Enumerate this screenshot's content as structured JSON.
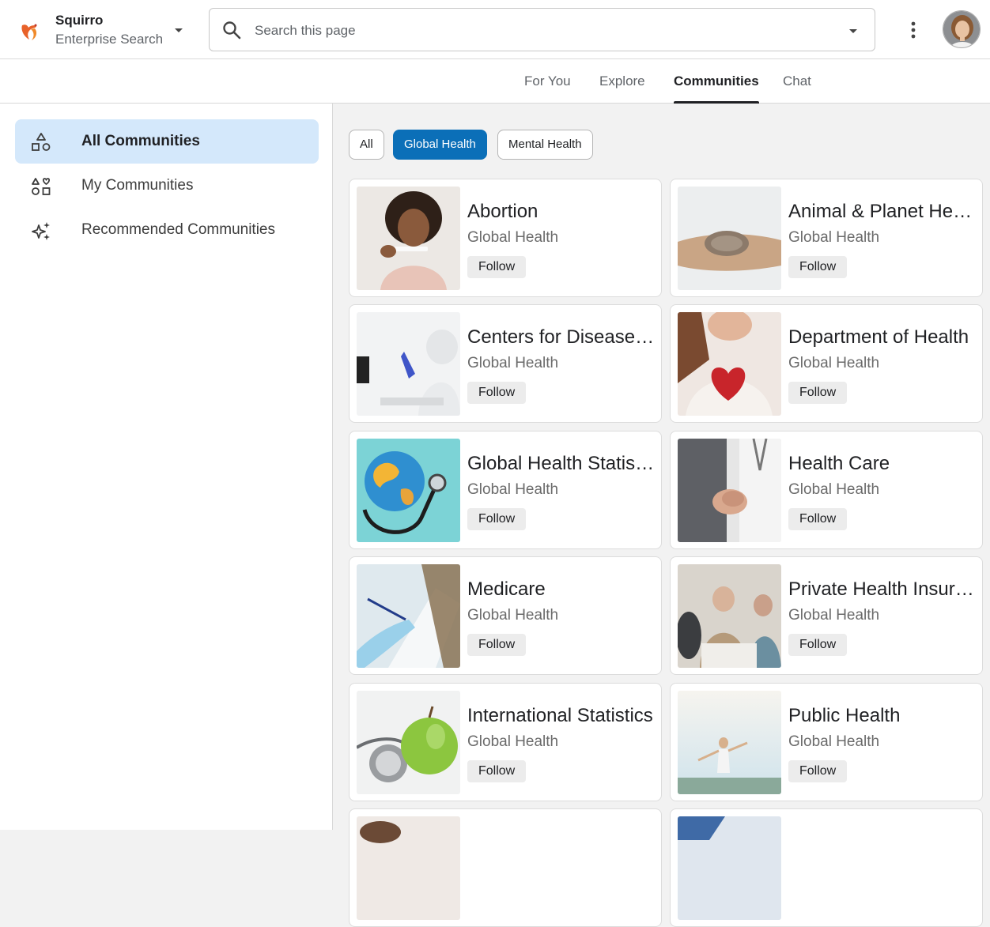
{
  "header": {
    "brand_name": "Squirro",
    "brand_subtitle": "Enterprise Search",
    "search_placeholder": "Search this page"
  },
  "tabs": [
    {
      "label": "For You",
      "active": false
    },
    {
      "label": "Explore",
      "active": false
    },
    {
      "label": "Communities",
      "active": true
    },
    {
      "label": "Chat",
      "active": false
    }
  ],
  "sidebar": {
    "items": [
      {
        "label": "All Communities",
        "icon": "shapes-icon",
        "active": true
      },
      {
        "label": "My Communities",
        "icon": "heart-shapes-icon",
        "active": false
      },
      {
        "label": "Recommended Communities",
        "icon": "sparkles-icon",
        "active": false
      }
    ]
  },
  "filters": [
    {
      "label": "All",
      "active": false
    },
    {
      "label": "Global Health",
      "active": true
    },
    {
      "label": "Mental Health",
      "active": false
    }
  ],
  "cards": [
    {
      "title": "Abortion",
      "subtitle": "Global Health",
      "follow": "Follow",
      "image": "woman-pregnancy-test"
    },
    {
      "title": "Animal & Planet Health",
      "subtitle": "Global Health",
      "follow": "Follow",
      "image": "paw-in-hand"
    },
    {
      "title": "Centers for Disease Control",
      "subtitle": "Global Health",
      "follow": "Follow",
      "image": "lab-scientist"
    },
    {
      "title": "Department of Health",
      "subtitle": "Global Health",
      "follow": "Follow",
      "image": "woman-holding-heart"
    },
    {
      "title": "Global Health Statistics",
      "subtitle": "Global Health",
      "follow": "Follow",
      "image": "globe-stethoscope"
    },
    {
      "title": "Health Care",
      "subtitle": "Global Health",
      "follow": "Follow",
      "image": "holding-hands"
    },
    {
      "title": "Medicare",
      "subtitle": "Global Health",
      "follow": "Follow",
      "image": "clipboard-glove"
    },
    {
      "title": "Private Health Insurance",
      "subtitle": "Global Health",
      "follow": "Follow",
      "image": "senior-couple-meeting"
    },
    {
      "title": "International Statistics",
      "subtitle": "Global Health",
      "follow": "Follow",
      "image": "apple-stethoscope"
    },
    {
      "title": "Public Health",
      "subtitle": "Global Health",
      "follow": "Follow",
      "image": "woman-open-arms"
    }
  ],
  "colors": {
    "accent": "#0b6fb8",
    "sidebar_active": "#d4e8fb",
    "logo": "#e8622a"
  }
}
